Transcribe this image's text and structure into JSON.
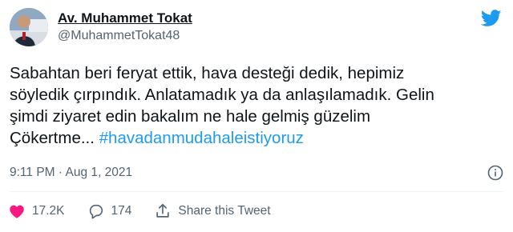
{
  "user": {
    "display_name": "Av. Muhammet Tokat",
    "handle": "@MuhammetTokat48",
    "avatar_icon": "profile-photo"
  },
  "brand": {
    "logo_icon": "twitter-bird-icon",
    "color": "#1d9bf0"
  },
  "tweet": {
    "text_lines": [
      "Sabahtan beri feryat ettik, hava desteği dedik, hepimiz",
      "söyledik çırpındık. Anlatamadık ya da anlaşılamadık. Gelin",
      "şimdi ziyaret edin bakalım ne hale gelmiş güzelim"
    ],
    "last_line_text": "Çökertme... ",
    "hashtag": "#havadanmudahaleistiyoruz",
    "timestamp": "9:11 PM · Aug 1, 2021"
  },
  "actions": {
    "likes_count": "17.2K",
    "replies_count": "174",
    "share_label": "Share this Tweet"
  },
  "colors": {
    "text": "#0f1419",
    "secondary": "#536471",
    "like": "#f91880",
    "link": "#1d9bf0"
  }
}
